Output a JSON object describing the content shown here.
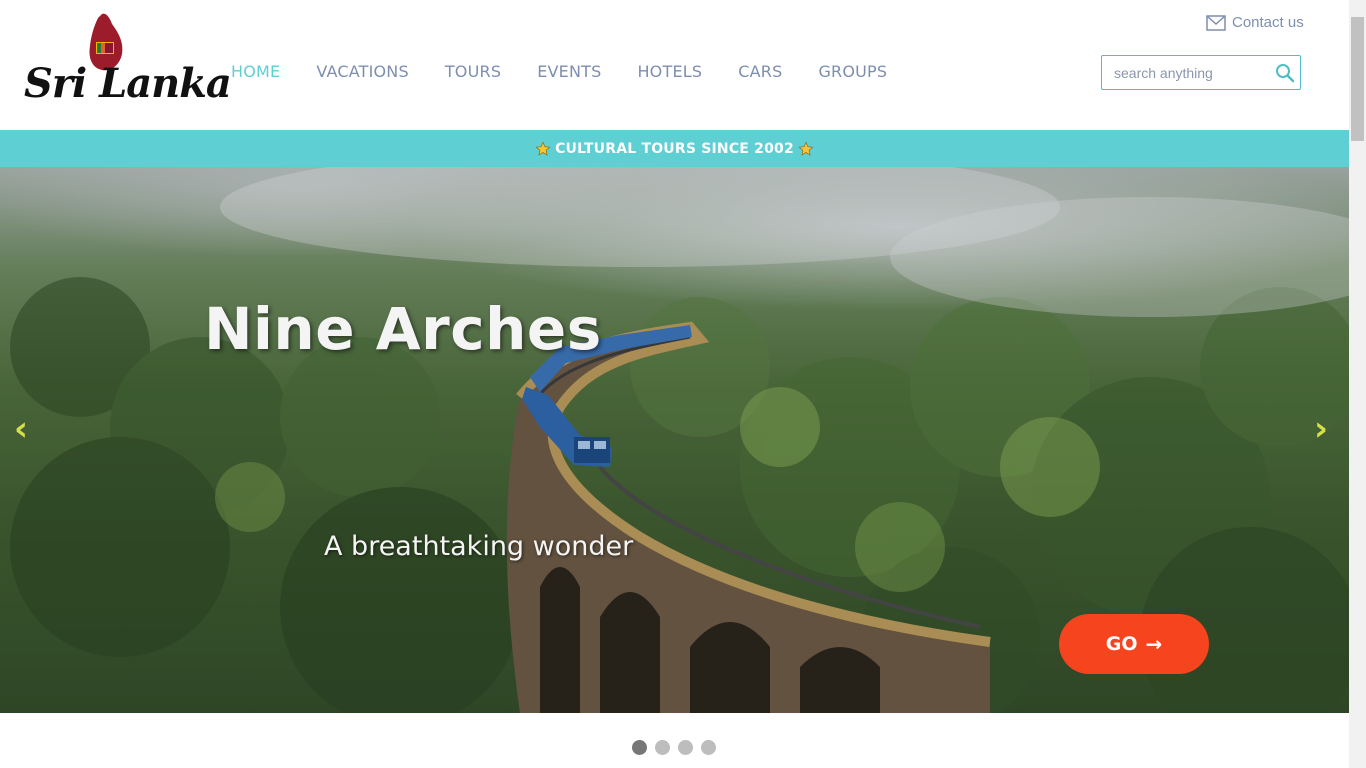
{
  "header": {
    "logo_text": "Sri Lanka",
    "contact_label": "Contact us",
    "search_placeholder": "search anything"
  },
  "nav": {
    "items": [
      {
        "label": "HOME",
        "active": true
      },
      {
        "label": "VACATIONS",
        "active": false
      },
      {
        "label": "TOURS",
        "active": false
      },
      {
        "label": "EVENTS",
        "active": false
      },
      {
        "label": "HOTELS",
        "active": false
      },
      {
        "label": "CARS",
        "active": false
      },
      {
        "label": "GROUPS",
        "active": false
      }
    ]
  },
  "banner": {
    "text": "CULTURAL TOURS SINCE 2002",
    "icon": "star-icon"
  },
  "hero": {
    "title": "Nine Arches",
    "subtitle": "A breathtaking wonder",
    "cta_label": "GO",
    "prev_arrow": "‹",
    "next_arrow": "›"
  },
  "carousel": {
    "slide_count": 4,
    "active_index": 0
  },
  "colors": {
    "accent": "#5ecfd2",
    "nav": "#7d8eb0",
    "cta": "#f5441e",
    "arrow": "#d4e04a"
  }
}
